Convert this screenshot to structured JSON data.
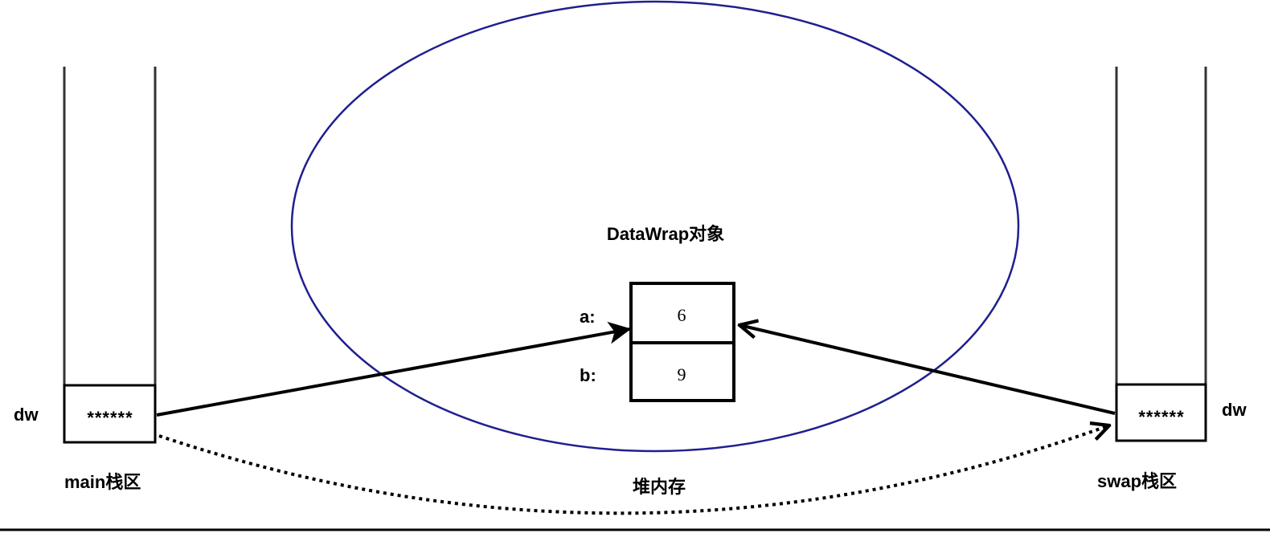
{
  "heap": {
    "label": "堆内存",
    "object_label": "DataWrap对象",
    "fields": [
      {
        "name": "a:",
        "value": "6"
      },
      {
        "name": "b:",
        "value": "9"
      }
    ],
    "ellipse_color": "#1f1f8f"
  },
  "main_stack": {
    "label": "main栈区",
    "var_name": "dw",
    "var_value": "******"
  },
  "swap_stack": {
    "label": "swap栈区",
    "var_name": "dw",
    "var_value": "******"
  }
}
